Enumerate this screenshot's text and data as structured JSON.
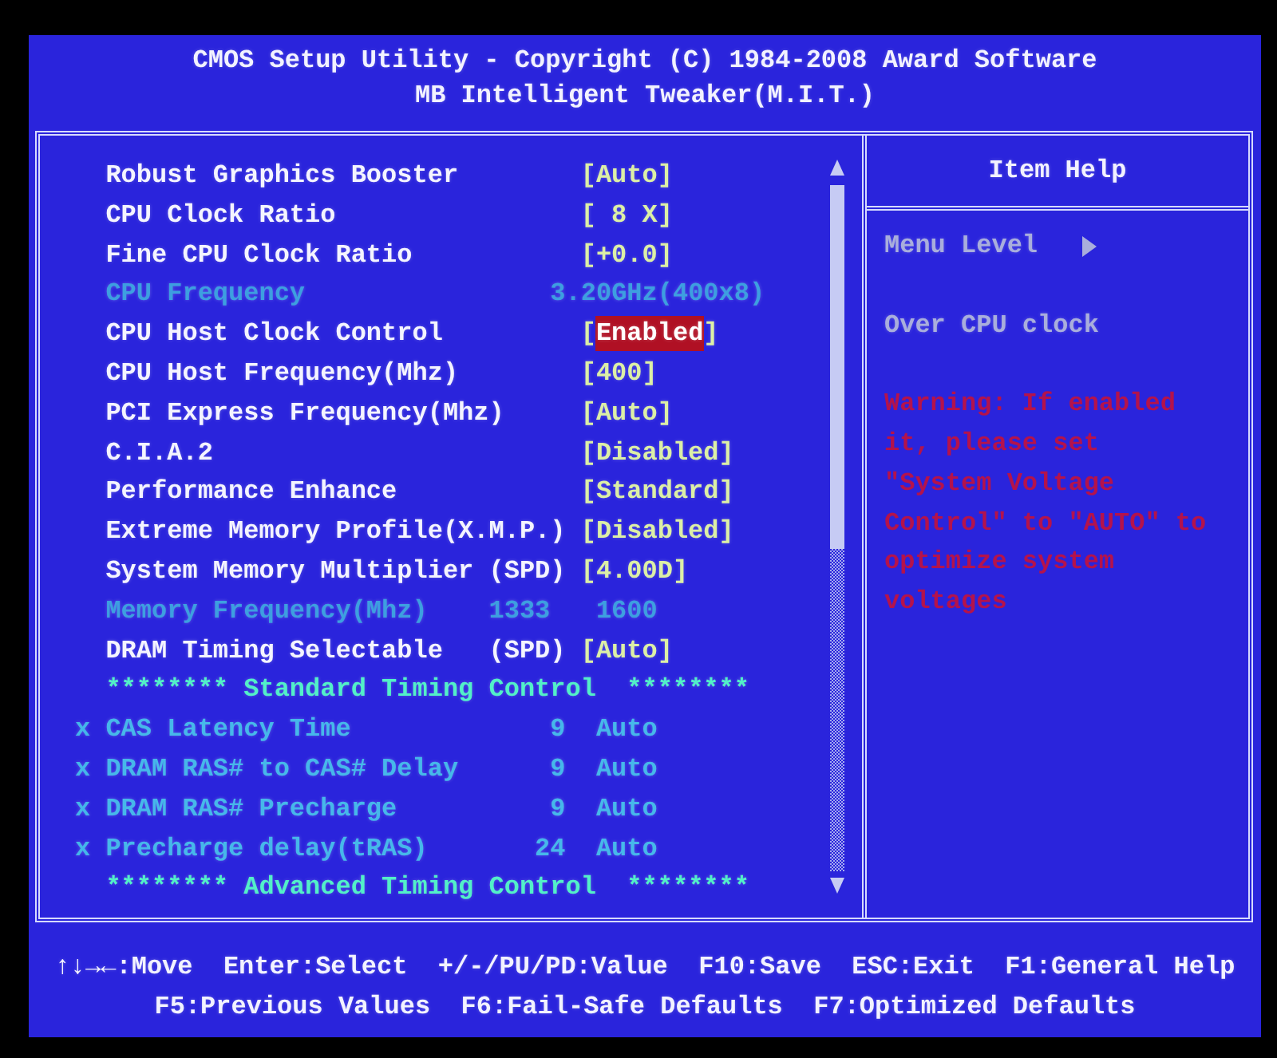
{
  "title": "CMOS Setup Utility - Copyright (C) 1984-2008 Award Software",
  "subtitle": "MB Intelligent Tweaker(M.I.T.)",
  "rows": [
    {
      "kind": "option",
      "label": "Robust Graphics Booster",
      "value": "[Auto]",
      "selected": false
    },
    {
      "kind": "option",
      "label": "CPU Clock Ratio",
      "value": "[ 8 X]",
      "selected": false
    },
    {
      "kind": "option",
      "label": "Fine CPU Clock Ratio",
      "value": "[+0.0]",
      "selected": false
    },
    {
      "kind": "readonly",
      "label": "CPU Frequency",
      "value": "3.20GHz(400x8)",
      "selected": false
    },
    {
      "kind": "option",
      "label": "CPU Host Clock Control",
      "value": "[Enabled]",
      "selected": true
    },
    {
      "kind": "option",
      "label": "CPU Host Frequency(Mhz)",
      "value": "[400]",
      "selected": false
    },
    {
      "kind": "option",
      "label": "PCI Express Frequency(Mhz)",
      "value": "[Auto]",
      "selected": false
    },
    {
      "kind": "option",
      "label": "C.I.A.2",
      "value": "[Disabled]",
      "selected": false
    },
    {
      "kind": "option",
      "label": "Performance Enhance",
      "value": "[Standard]",
      "selected": false
    },
    {
      "kind": "option",
      "label": "Extreme Memory Profile(X.M.P.)",
      "value": "[Disabled]",
      "selected": false
    },
    {
      "kind": "option",
      "label": "System Memory Multiplier",
      "tag": "(SPD)",
      "value": "[4.00D]",
      "selected": false
    },
    {
      "kind": "readout",
      "label": "Memory Frequency(Mhz)",
      "values": [
        "1333",
        "1600"
      ],
      "selected": false
    },
    {
      "kind": "option",
      "label": "DRAM Timing Selectable",
      "tag": "(SPD)",
      "value": "[Auto]",
      "selected": false
    },
    {
      "kind": "section",
      "label": "******** Standard Timing Control  ********",
      "selected": false
    },
    {
      "kind": "locked",
      "mark": "x",
      "label": "CAS Latency Time",
      "value": "9",
      "mode": "Auto",
      "selected": false
    },
    {
      "kind": "locked",
      "mark": "x",
      "label": "DRAM RAS# to CAS# Delay",
      "value": "9",
      "mode": "Auto",
      "selected": false
    },
    {
      "kind": "locked",
      "mark": "x",
      "label": "DRAM RAS# Precharge",
      "value": "9",
      "mode": "Auto",
      "selected": false
    },
    {
      "kind": "locked",
      "mark": "x",
      "label": "Precharge delay(tRAS)",
      "value": "24",
      "mode": "Auto",
      "selected": false
    },
    {
      "kind": "section",
      "label": "******** Advanced Timing Control  ********",
      "selected": false
    }
  ],
  "help": {
    "title": "Item Help",
    "menu_level": "Menu Level",
    "description": "Over CPU clock",
    "warning": "Warning: If enabled\nit, please set\n\"System Voltage\nControl\" to \"AUTO\" to\noptimize system\nvoltages"
  },
  "key_hints": [
    [
      "↑↓→←:Move",
      "Enter:Select",
      "+/-/PU/PD:Value",
      "F10:Save",
      "ESC:Exit",
      "F1:General Help"
    ],
    [
      "F5:Previous Values",
      "F6:Fail-Safe Defaults",
      "F7:Optimized Defaults"
    ]
  ]
}
